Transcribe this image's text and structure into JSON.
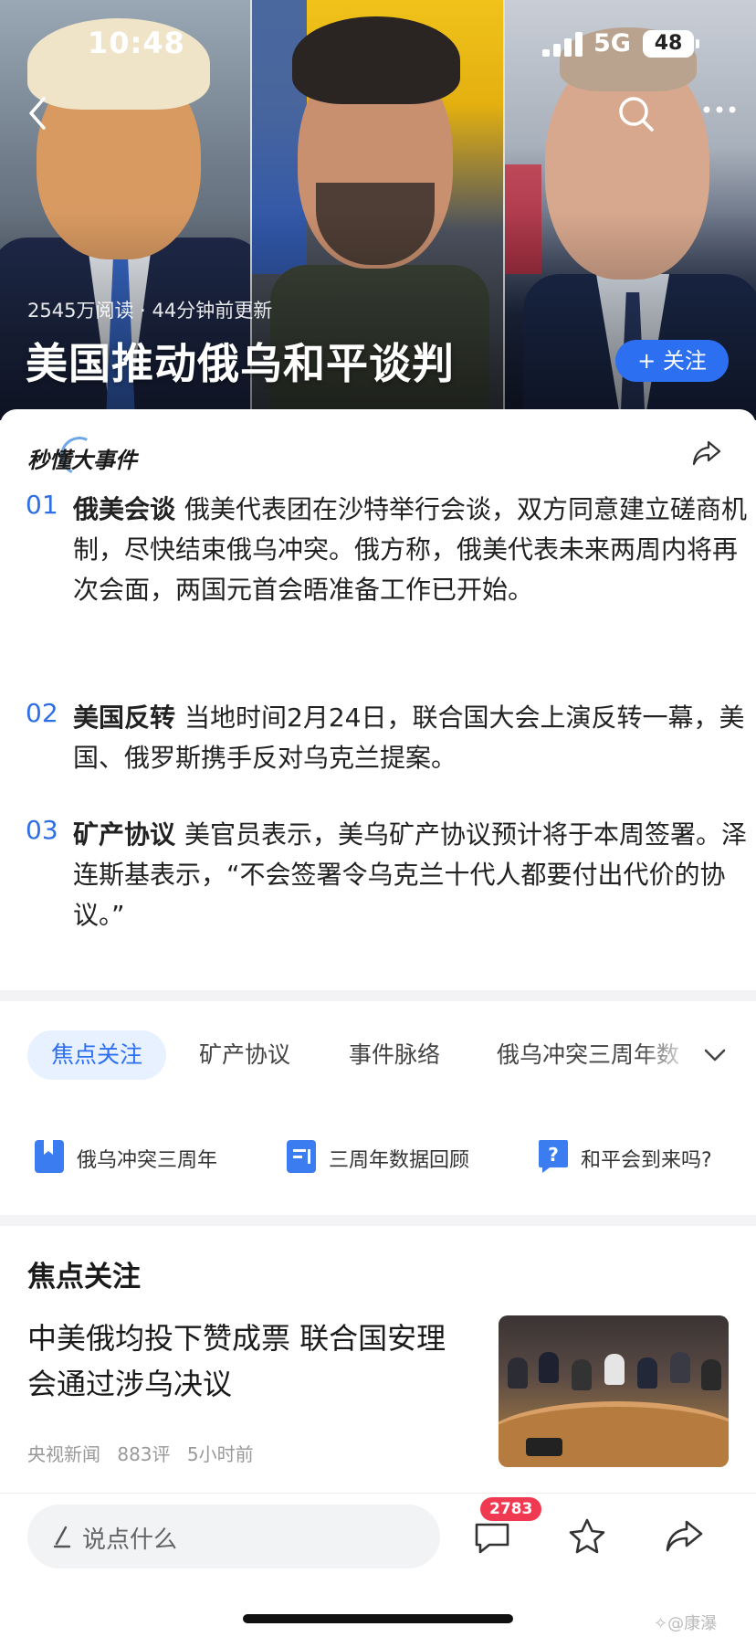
{
  "status_bar": {
    "time": "10:48",
    "network": "5G",
    "battery": "48"
  },
  "hero": {
    "meta": "2545万阅读 · 44分钟前更新",
    "title": "美国推动俄乌和平谈判",
    "follow_label": "+ 关注"
  },
  "summary": {
    "brand": "秒懂大事件",
    "items": [
      {
        "num": "01",
        "keyword": "俄美会谈",
        "text": "俄美代表团在沙特举行会谈，双方同意建立磋商机制，尽快结束俄乌冲突。俄方称，俄美代表未来两周内将再次会面，两国元首会晤准备工作已开始。"
      },
      {
        "num": "02",
        "keyword": "美国反转",
        "text": "当地时间2月24日，联合国大会上演反转一幕，美国、俄罗斯携手反对乌克兰提案。"
      },
      {
        "num": "03",
        "keyword": "矿产协议",
        "text": "美官员表示，美乌矿产协议预计将于本周签署。泽连斯基表示，“不会签署令乌克兰十代人都要付出代价的协议。”"
      }
    ]
  },
  "tabs": {
    "items": [
      {
        "label": "焦点关注"
      },
      {
        "label": "矿产协议"
      },
      {
        "label": "事件脉络"
      },
      {
        "label": "俄乌冲突三周年数"
      }
    ]
  },
  "quick_links": [
    {
      "label": "俄乌冲突三周年",
      "icon": "bookmark-icon"
    },
    {
      "label": "三周年数据回顾",
      "icon": "document-icon"
    },
    {
      "label": "和平会到来吗?",
      "icon": "question-icon"
    }
  ],
  "focus": {
    "heading": "焦点关注",
    "news_title": "中美俄均投下赞成票 联合国安理会通过涉乌决议",
    "source": "央视新闻",
    "comments": "883评",
    "time": "5小时前"
  },
  "bottom_bar": {
    "placeholder": "说点什么",
    "comment_count": "2783",
    "watermark": "✧@康瀑"
  },
  "colors": {
    "accent": "#2c6ff0",
    "badge": "#f03a52",
    "number": "#2f6fe6"
  }
}
